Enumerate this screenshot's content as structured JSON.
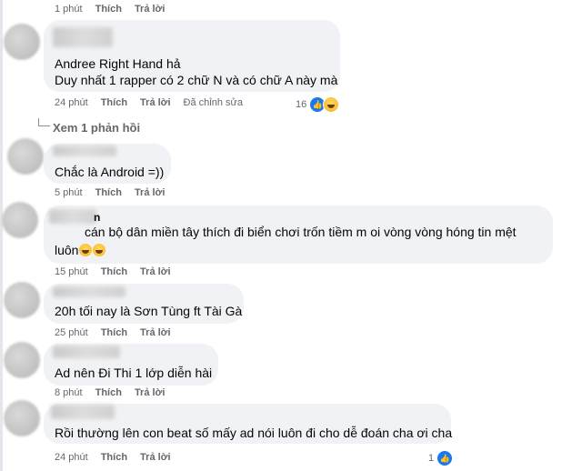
{
  "top_actions": {
    "time": "1 phút",
    "like": "Thích",
    "reply": "Trả lời"
  },
  "comments": [
    {
      "lines": [
        "Andree Right Hand hả",
        "Duy nhất 1 rapper có 2 chữ N và có chữ A này mà"
      ],
      "time": "24 phút",
      "like": "Thích",
      "reply": "Trả lời",
      "edited": "Đã chỉnh sửa",
      "reaction_count": "16"
    },
    {
      "lines": [
        "Chắc là Android =))"
      ],
      "time": "5 phút",
      "like": "Thích",
      "reply": "Trả lời"
    },
    {
      "name_partial": "n",
      "lines": [
        "cán bộ dân miền tây thích đi biển chơi trốn tiềm m oi vòng vòng hóng tin mệt",
        "luôn"
      ],
      "time": "15 phút",
      "like": "Thích",
      "reply": "Trả lời"
    },
    {
      "lines": [
        "20h tối nay là Sơn Tùng ft Tài Gà"
      ],
      "time": "25 phút",
      "like": "Thích",
      "reply": "Trả lời"
    },
    {
      "lines": [
        "Ad nên Đi Thi 1 lớp diễn hài"
      ],
      "time": "8 phút",
      "like": "Thích",
      "reply": "Trả lời"
    },
    {
      "lines": [
        "Rồi thường lên con beat số mấy ad nói luôn đi cho dễ đoán cha ơi cha"
      ],
      "time": "24 phút",
      "like": "Thích",
      "reply": "Trả lời",
      "reaction_count": "1"
    }
  ],
  "view_replies": "Xem 1 phản hồi",
  "icons": {
    "like": "thumbs-up-icon",
    "haha": "laughing-emoji-icon"
  },
  "colors": {
    "bubble": "#f0f2f5",
    "meta": "#65676b",
    "like": "#1877f2"
  }
}
